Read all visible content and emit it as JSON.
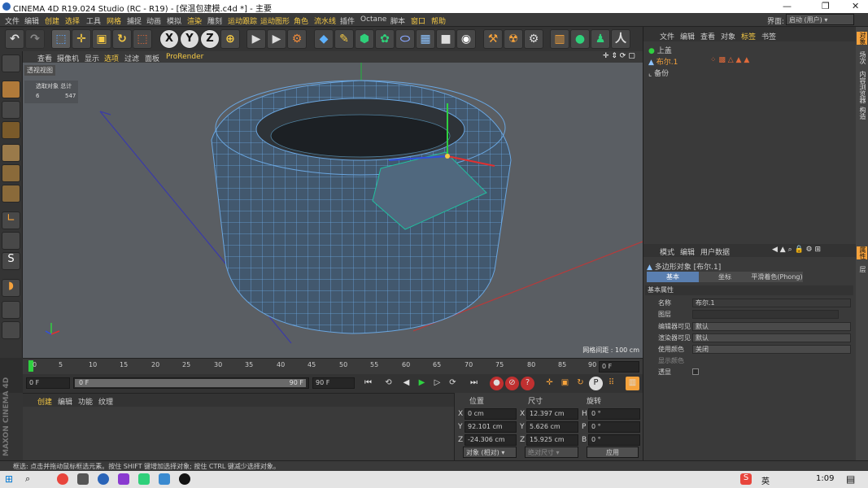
{
  "window": {
    "title": "CINEMA 4D R19.024 Studio (RC - R19) - [保温包建模.c4d *] - 主要",
    "min": "—",
    "max": "❐",
    "close": "✕"
  },
  "menu": {
    "items": [
      "文件",
      "编辑",
      "创建",
      "选择",
      "工具",
      "网格",
      "捕捉",
      "动画",
      "模拟",
      "渲染",
      "雕刻",
      "运动跟踪",
      "运动图形",
      "角色",
      "流水线",
      "插件",
      "Octane",
      "脚本",
      "窗口",
      "帮助"
    ],
    "highlighted": [
      2,
      3,
      5,
      9,
      11,
      12,
      13,
      14,
      18,
      19
    ],
    "layout_label": "界面:",
    "layout_value": "启动 (用户)"
  },
  "viewport": {
    "menu": [
      "查看",
      "摄像机",
      "显示",
      "选项",
      "过滤",
      "面板",
      "ProRender"
    ],
    "active_menu": "选项",
    "prorender_color": "#f5c945",
    "title": "透视视图",
    "stats_header": "选取对象  总计",
    "stats_row_a": "6",
    "stats_row_b": "547",
    "grid_spacing": "网格间距 : 100 cm"
  },
  "timeline": {
    "ticks": [
      "0",
      "5",
      "10",
      "15",
      "20",
      "25",
      "30",
      "35",
      "40",
      "45",
      "50",
      "55",
      "60",
      "65",
      "70",
      "75",
      "80",
      "85",
      "90"
    ],
    "frame_field": "0 F"
  },
  "transport": {
    "start": "0 F",
    "range_start": "0 F",
    "range_end": "90 F",
    "end": "90 F"
  },
  "material": {
    "tabs": [
      "创建",
      "编辑",
      "功能",
      "纹理"
    ]
  },
  "coords": {
    "headers": [
      "位置",
      "尺寸",
      "旋转"
    ],
    "rows": [
      {
        "axis": "X",
        "pos": "0 cm",
        "size_axis": "X",
        "size": "12.397 cm",
        "rot_axis": "H",
        "rot": "0 °"
      },
      {
        "axis": "Y",
        "pos": "92.101 cm",
        "size_axis": "Y",
        "size": "5.626 cm",
        "rot_axis": "P",
        "rot": "0 °"
      },
      {
        "axis": "Z",
        "pos": "-24.306 cm",
        "size_axis": "Z",
        "size": "15.925 cm",
        "rot_axis": "B",
        "rot": "0 °"
      }
    ],
    "mode": "对象 (相对)",
    "size_mode": "绝对尺寸",
    "apply": "应用"
  },
  "objects": {
    "menu": [
      "文件",
      "编辑",
      "查看",
      "对象",
      "标签",
      "书签"
    ],
    "active_menu": "标签",
    "items": [
      {
        "name": "上盖",
        "color": "#cfcfcf"
      },
      {
        "name": "布尔.1",
        "color": "#f5a23c"
      },
      {
        "name": "备份",
        "color": "#cfcfcf"
      }
    ]
  },
  "attributes": {
    "menu": [
      "模式",
      "编辑",
      "用户数据"
    ],
    "object_title": "多边形对象 [布尔.1]",
    "tabs": [
      "基本",
      "坐标",
      "平滑着色(Phong)"
    ],
    "section": "基本属性",
    "name_label": "名称",
    "name_value": "布尔.1",
    "layer_label": "图层",
    "editor_visible_label": "编辑器可见",
    "editor_visible_value": "默认",
    "render_visible_label": "渲染器可见",
    "render_visible_value": "默认",
    "use_color_label": "使用颜色",
    "use_color_value": "关闭",
    "display_color_label": "显示颜色",
    "xray_label": "透显"
  },
  "side_tabs": [
    "对象",
    "场次",
    "内容浏览器",
    "构造",
    "属性",
    "层"
  ],
  "status": "框选: 点击并拖动鼠标框选元素。按住 SHIFT 键增加选择对象; 按住 CTRL 键减少选择对象。",
  "maxon": "MAXON CINEMA 4D",
  "taskbar": {
    "time": "1:09",
    "ime": "英"
  }
}
